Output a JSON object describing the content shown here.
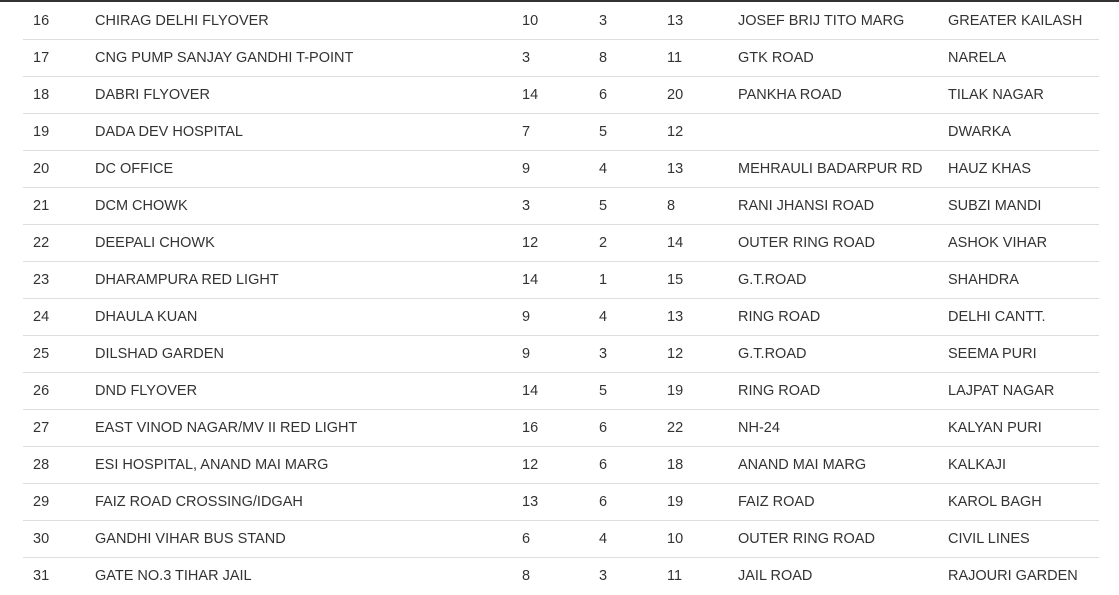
{
  "table": {
    "rows": [
      [
        "16",
        "CHIRAG DELHI FLYOVER",
        "10",
        "3",
        "13",
        "JOSEF BRIJ TITO MARG",
        "GREATER KAILASH"
      ],
      [
        "17",
        "CNG PUMP SANJAY GANDHI T-POINT",
        "3",
        "8",
        "11",
        "GTK ROAD",
        "NARELA"
      ],
      [
        "18",
        "DABRI FLYOVER",
        "14",
        "6",
        "20",
        "PANKHA ROAD",
        "TILAK NAGAR"
      ],
      [
        "19",
        "DADA DEV HOSPITAL",
        "7",
        "5",
        "12",
        "",
        "DWARKA"
      ],
      [
        "20",
        "DC OFFICE",
        "9",
        "4",
        "13",
        "MEHRAULI BADARPUR RD",
        "HAUZ KHAS"
      ],
      [
        "21",
        "DCM CHOWK",
        "3",
        "5",
        "8",
        "RANI JHANSI ROAD",
        "SUBZI MANDI"
      ],
      [
        "22",
        "DEEPALI CHOWK",
        "12",
        "2",
        "14",
        "OUTER RING ROAD",
        "ASHOK VIHAR"
      ],
      [
        "23",
        "DHARAMPURA RED LIGHT",
        "14",
        "1",
        "15",
        "G.T.ROAD",
        "SHAHDRA"
      ],
      [
        "24",
        "DHAULA KUAN",
        "9",
        "4",
        "13",
        "RING ROAD",
        "DELHI CANTT."
      ],
      [
        "25",
        "DILSHAD GARDEN",
        "9",
        "3",
        "12",
        "G.T.ROAD",
        "SEEMA PURI"
      ],
      [
        "26",
        "DND FLYOVER",
        "14",
        "5",
        "19",
        "RING ROAD",
        "LAJPAT NAGAR"
      ],
      [
        "27",
        "EAST VINOD NAGAR/MV II RED LIGHT",
        "16",
        "6",
        "22",
        "NH-24",
        "KALYAN PURI"
      ],
      [
        "28",
        "ESI HOSPITAL, ANAND MAI MARG",
        "12",
        "6",
        "18",
        "ANAND MAI MARG",
        "KALKAJI"
      ],
      [
        "29",
        "FAIZ ROAD CROSSING/IDGAH",
        "13",
        "6",
        "19",
        "FAIZ ROAD",
        "KAROL BAGH"
      ],
      [
        "30",
        "GANDHI VIHAR BUS STAND",
        "6",
        "4",
        "10",
        "OUTER RING ROAD",
        "CIVIL LINES"
      ],
      [
        "31",
        "GATE NO.3 TIHAR JAIL",
        "8",
        "3",
        "11",
        "JAIL ROAD",
        "RAJOURI GARDEN"
      ]
    ]
  }
}
